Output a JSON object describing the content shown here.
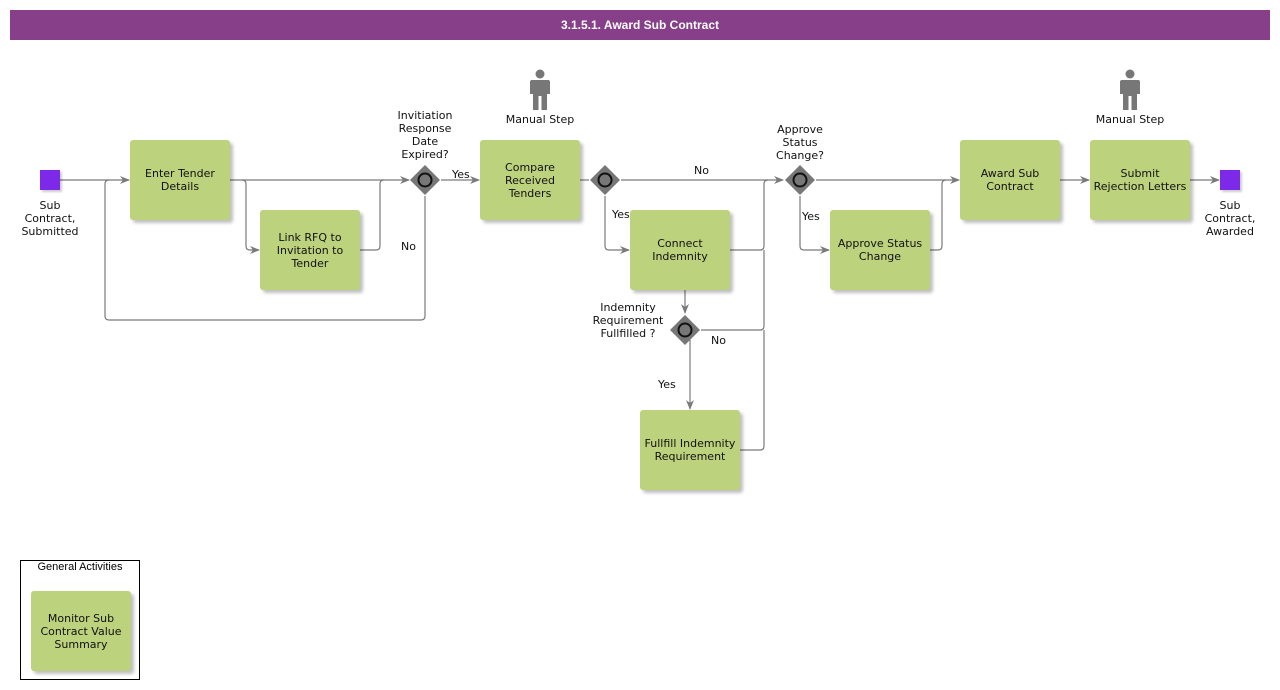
{
  "title": "3.1.5.1. Award Sub Contract",
  "colors": {
    "header": "#873f8a",
    "task": "#bdd27d",
    "event": "#7d2ae8",
    "gateway": "#777777",
    "connector": "#7a7a7a"
  },
  "events": {
    "start": "Sub\nContract,\nSubmitted",
    "end": "Sub\nContract,\nAwarded"
  },
  "tasks": {
    "enter_tender": "Enter Tender\nDetails",
    "link_rfq": "Link RFQ to\nInvitation to\nTender",
    "compare_tenders": "Compare\nReceived\nTenders",
    "connect_indemnity": "Connect\nIndemnity",
    "fulfill_indemnity": "Fullfill Indemnity\nRequirement",
    "approve_status": "Approve Status\nChange",
    "award_sub": "Award Sub\nContract",
    "submit_rejection": "Submit\nRejection Letters",
    "monitor": "Monitor Sub\nContract Value\nSummary"
  },
  "gateways": {
    "invitation_expired": "Invitiation\nResponse\nDate\nExpired?",
    "indemnity_fulfilled": "Indemnity\nRequirement\nFullfilled ?",
    "approve_status_change": "Approve\nStatus\nChange?"
  },
  "annotations": {
    "manual_step_1": "Manual Step",
    "manual_step_2": "Manual Step"
  },
  "edge_labels": {
    "yes_invitation": "Yes",
    "no_invitation": "No",
    "yes_compare": "Yes",
    "no_compare": "No",
    "yes_indemnity": "Yes",
    "no_indemnity": "No",
    "yes_approve": "Yes"
  },
  "group": {
    "title": "General Activities"
  }
}
